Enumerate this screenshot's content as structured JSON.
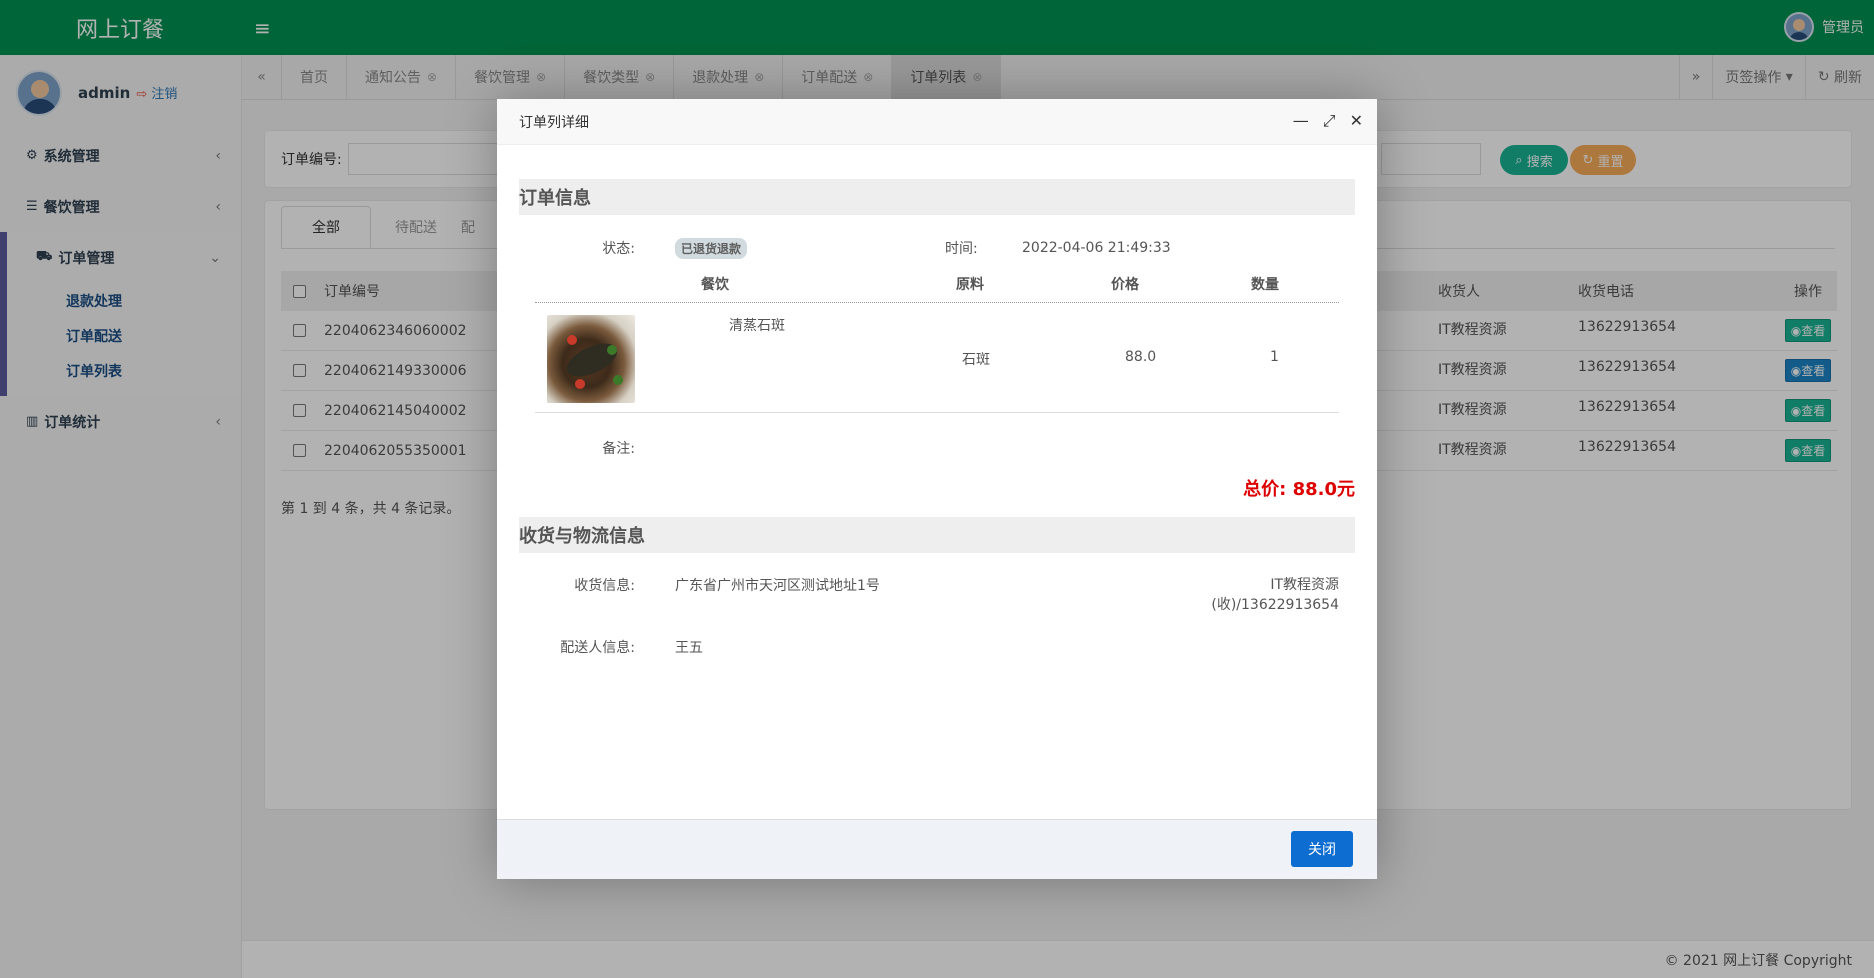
{
  "header": {
    "brand": "网上订餐",
    "user": "管理员"
  },
  "sidebar": {
    "profile": {
      "name": "admin",
      "logout": "注销"
    },
    "menu": [
      {
        "label": "系统管理"
      },
      {
        "label": "餐饮管理"
      },
      {
        "label": "订单管理"
      },
      {
        "label": "订单统计"
      }
    ],
    "submenu": [
      "退款处理",
      "订单配送",
      "订单列表"
    ]
  },
  "tabs": [
    "首页",
    "通知公告",
    "餐饮管理",
    "餐饮类型",
    "退款处理",
    "订单配送",
    "订单列表"
  ],
  "tabs_right": {
    "page_ops": "页签操作",
    "refresh": "刷新"
  },
  "search": {
    "label": "订单编号:",
    "search_btn": "搜索",
    "reset_btn": "重置"
  },
  "list": {
    "tabs": [
      "全部",
      "待配送",
      "配"
    ],
    "headers": {
      "order_no": "订单编号",
      "receiver": "收货人",
      "phone": "收货电话",
      "op": "操作"
    },
    "rows": [
      {
        "order_no": "2204062346060002",
        "receiver": "IT教程资源",
        "phone": "13622913654",
        "op": "查看"
      },
      {
        "order_no": "2204062149330006",
        "receiver": "IT教程资源",
        "phone": "13622913654",
        "op": "查看"
      },
      {
        "order_no": "2204062145040002",
        "receiver": "IT教程资源",
        "phone": "13622913654",
        "op": "查看"
      },
      {
        "order_no": "2204062055350001",
        "receiver": "IT教程资源",
        "phone": "13622913654",
        "op": "查看"
      }
    ],
    "pager": "第 1 到 4 条，共 4 条记录。"
  },
  "footer": "© 2021 网上订餐 Copyright",
  "modal": {
    "title": "订单列详细",
    "order_section": "订单信息",
    "status_label": "状态:",
    "status_value": "已退货退款",
    "time_label": "时间:",
    "time_value": "2022-04-06 21:49:33",
    "dish_headers": {
      "food": "餐饮",
      "material": "原料",
      "price": "价格",
      "qty": "数量"
    },
    "dish": {
      "name": "清蒸石斑",
      "material": "石斑",
      "price": "88.0",
      "qty": "1"
    },
    "remark_label": "备注:",
    "total": "总价: 88.0元",
    "logistics_section": "收货与物流信息",
    "recv_label": "收货信息:",
    "recv_address": "广东省广州市天河区测试地址1号",
    "recv_name": "IT教程资源",
    "recv_phone": "(收)/13622913654",
    "courier_label": "配送人信息:",
    "courier_name": "王五",
    "close_btn": "关闭"
  }
}
